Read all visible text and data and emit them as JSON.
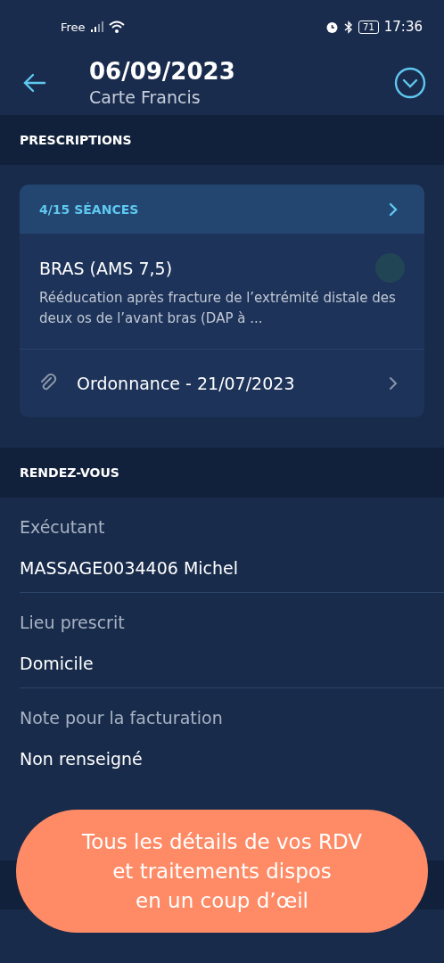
{
  "status_bar": {
    "carrier": "Free",
    "battery": "71",
    "time": "17:36"
  },
  "header": {
    "title": "06/09/2023",
    "subtitle": "Carte Francis"
  },
  "prescriptions": {
    "heading": "PRESCRIPTIONS",
    "card": {
      "sessions": "4/15 SÉANCES",
      "title": "BRAS (AMS 7,5)",
      "description": "Rééducation après fracture de l’extrémité distale des deux os de l’avant bras (DAP à ...",
      "document": "Ordonnance - 21/07/2023"
    }
  },
  "appointment": {
    "heading": "RENDEZ-VOUS",
    "fields": [
      {
        "label": "Exécutant",
        "value": "MASSAGE0034406 Michel"
      },
      {
        "label": "Lieu prescrit",
        "value": "Domicile"
      },
      {
        "label": "Note pour la facturation",
        "value": "Non renseigné"
      }
    ]
  },
  "callout": {
    "lines": [
      "Tous les détails de vos RDV",
      "et traitements dispos",
      "en un coup d’œil"
    ]
  }
}
